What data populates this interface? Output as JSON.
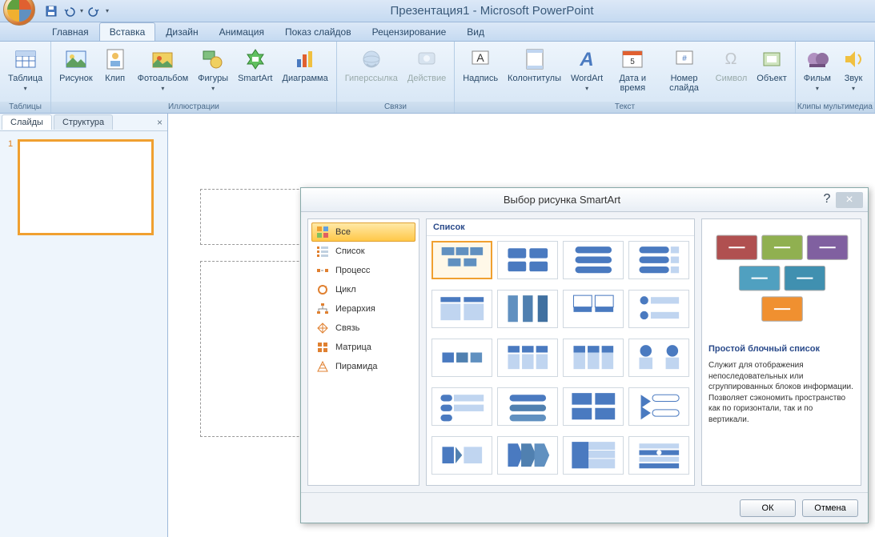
{
  "title": "Презентация1 - Microsoft PowerPoint",
  "qat": {
    "save": "save",
    "undo": "undo",
    "redo": "redo"
  },
  "tabs": {
    "home": "Главная",
    "insert": "Вставка",
    "design": "Дизайн",
    "animation": "Анимация",
    "slideshow": "Показ слайдов",
    "review": "Рецензирование",
    "view": "Вид"
  },
  "ribbon": {
    "tables": {
      "label": "Таблицы",
      "table": "Таблица"
    },
    "illustrations": {
      "label": "Иллюстрации",
      "picture": "Рисунок",
      "clip": "Клип",
      "album": "Фотоальбом",
      "shapes": "Фигуры",
      "smartart": "SmartArt",
      "chart": "Диаграмма"
    },
    "links": {
      "label": "Связи",
      "hyperlink": "Гиперссылка",
      "action": "Действие"
    },
    "text": {
      "label": "Текст",
      "textbox": "Надпись",
      "headerfooter": "Колонтитулы",
      "wordart": "WordArt",
      "datetime": "Дата и время",
      "slidenum": "Номер слайда",
      "symbol": "Символ",
      "object": "Объект"
    },
    "media": {
      "label": "Клипы мультимедиа",
      "movie": "Фильм",
      "sound": "Звук"
    }
  },
  "slidesPanel": {
    "slides": "Слайды",
    "outline": "Структура",
    "num1": "1"
  },
  "dialog": {
    "title": "Выбор рисунка SmartArt",
    "ok": "ОК",
    "cancel": "Отмена",
    "categories": {
      "all": "Все",
      "list": "Список",
      "process": "Процесс",
      "cycle": "Цикл",
      "hierarchy": "Иерархия",
      "relationship": "Связь",
      "matrix": "Матрица",
      "pyramid": "Пирамида"
    },
    "galleryHeader": "Список",
    "preview": {
      "title": "Простой блочный список",
      "desc": "Служит для отображения непоследовательных или сгруппированных блоков информации. Позволяет сэкономить пространство как по горизонтали, так и по вертикали."
    }
  }
}
